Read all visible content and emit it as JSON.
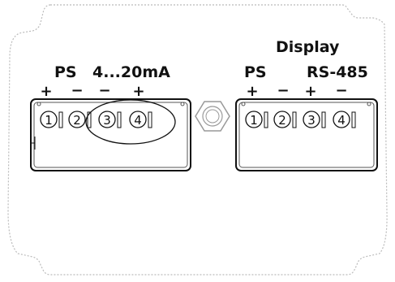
{
  "display_title": "Display",
  "left_block": {
    "group_labels": [
      "PS",
      "4...20mA"
    ],
    "polarity": [
      "+",
      "−",
      "−",
      "+"
    ],
    "terminals": [
      "1",
      "2",
      "3",
      "4"
    ]
  },
  "right_block": {
    "group_labels": [
      "PS",
      "RS-485"
    ],
    "polarity": [
      "+",
      "−",
      "+",
      "−"
    ],
    "terminals": [
      "1",
      "2",
      "3",
      "4"
    ]
  },
  "colors": {
    "line": "#111111",
    "enclosure": "#bbbbbb",
    "gland": "#999999"
  }
}
